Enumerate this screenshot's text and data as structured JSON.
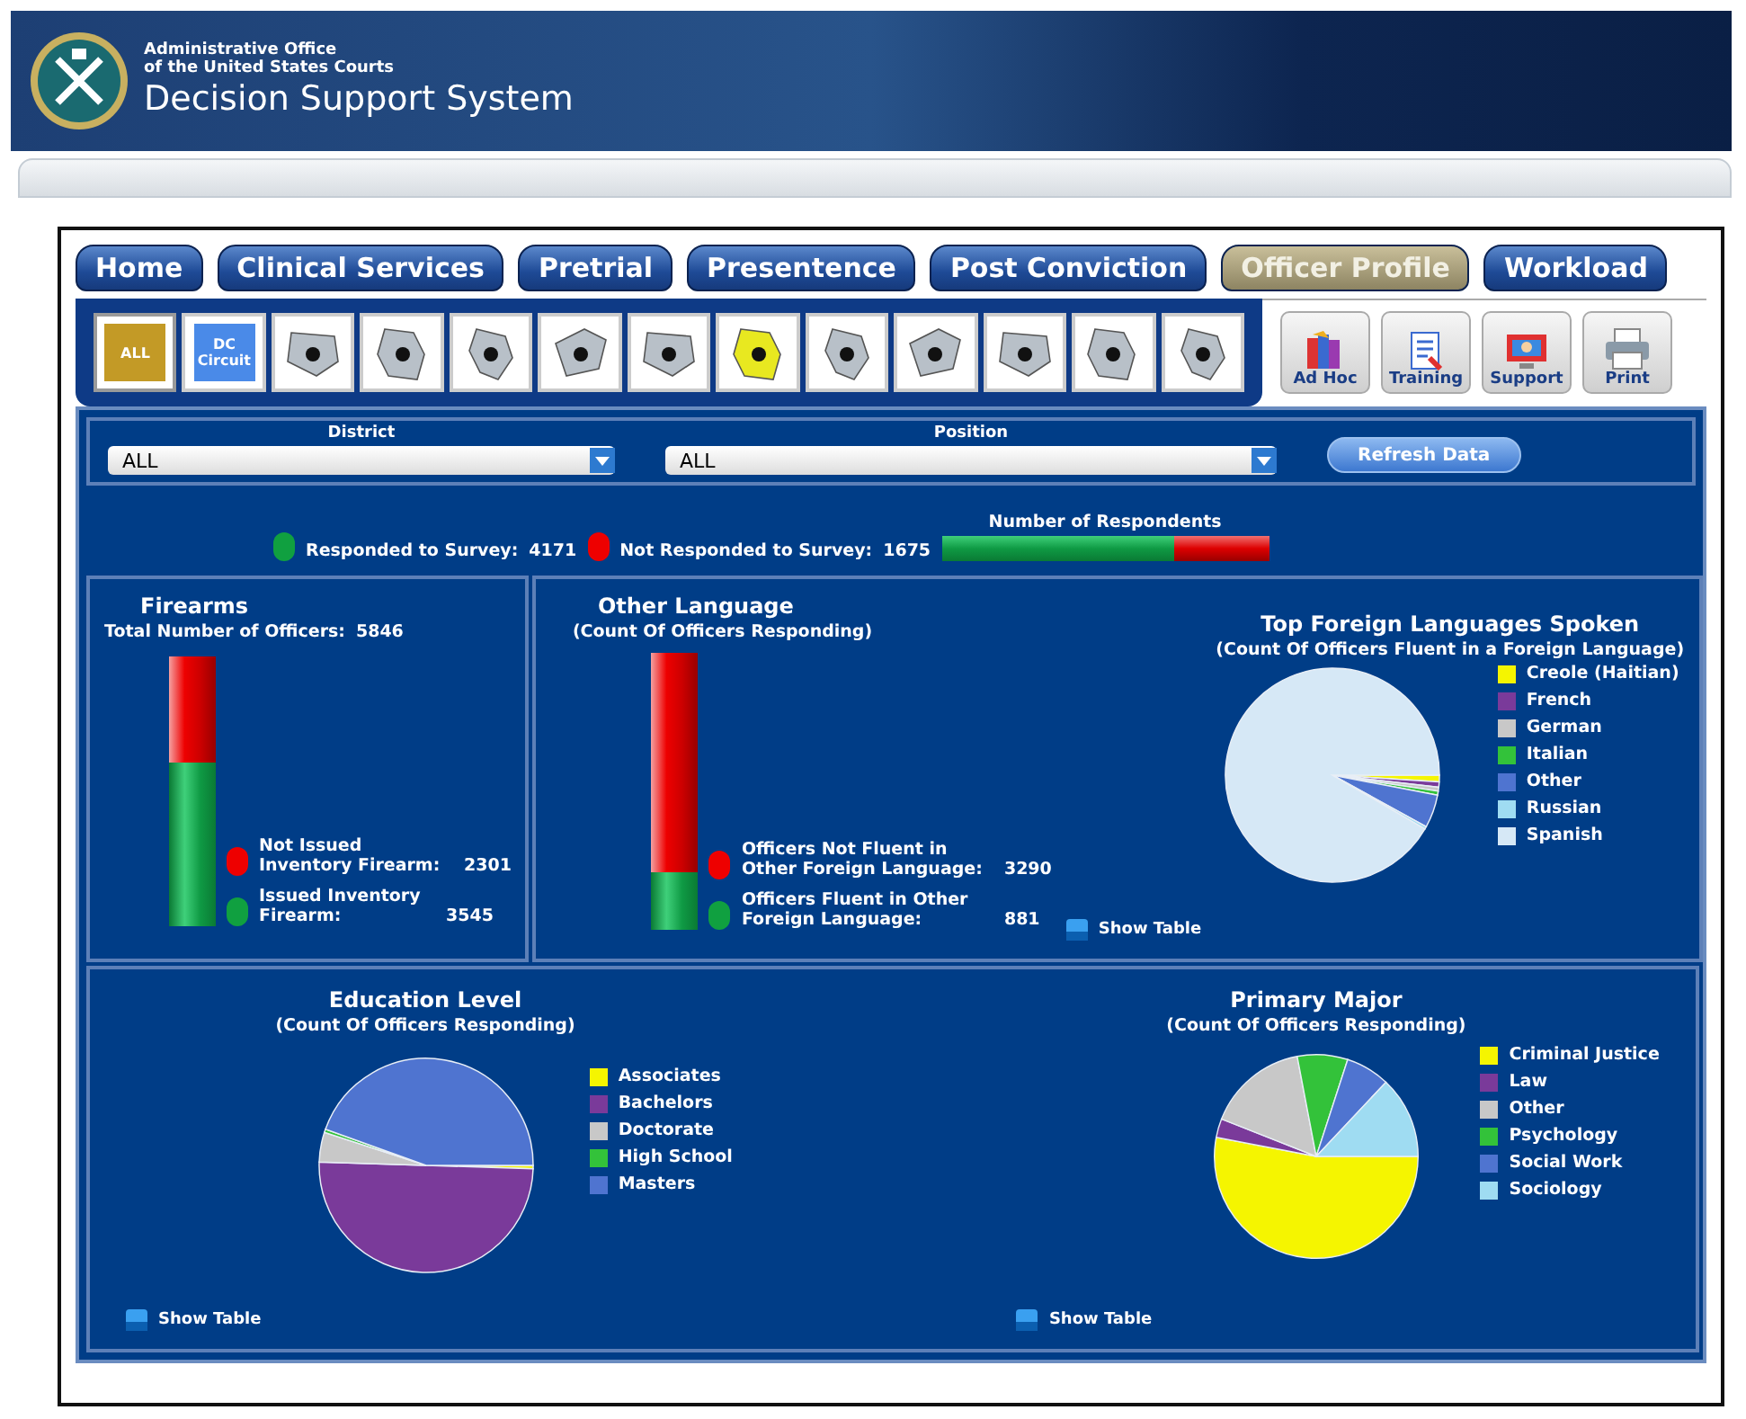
{
  "header": {
    "org_line_1": "Administrative Office",
    "org_line_2": "of the United States Courts",
    "title": "Decision Support System"
  },
  "tabs": [
    {
      "label": "Home",
      "selected": false
    },
    {
      "label": "Clinical Services",
      "selected": false
    },
    {
      "label": "Pretrial",
      "selected": false
    },
    {
      "label": "Presentence",
      "selected": false
    },
    {
      "label": "Post Conviction",
      "selected": false
    },
    {
      "label": "Officer Profile",
      "selected": true
    },
    {
      "label": "Workload",
      "selected": false
    }
  ],
  "districts": [
    {
      "kind": "label",
      "label": "ALL",
      "selected": true
    },
    {
      "kind": "label",
      "label": "DC Circuit",
      "selected": false
    },
    {
      "kind": "map",
      "selected": false
    },
    {
      "kind": "map",
      "selected": false
    },
    {
      "kind": "map",
      "selected": false
    },
    {
      "kind": "map",
      "selected": false
    },
    {
      "kind": "map",
      "selected": false
    },
    {
      "kind": "map",
      "selected": false
    },
    {
      "kind": "map",
      "selected": false
    },
    {
      "kind": "map",
      "selected": false
    },
    {
      "kind": "map",
      "selected": false
    },
    {
      "kind": "map",
      "selected": false
    },
    {
      "kind": "map",
      "selected": false
    }
  ],
  "tools": [
    {
      "kind": "adhoc",
      "label": "Ad Hoc"
    },
    {
      "kind": "training",
      "label": "Training"
    },
    {
      "kind": "support",
      "label": "Support"
    },
    {
      "kind": "print",
      "label": "Print"
    }
  ],
  "filters": {
    "district_label": "District",
    "district_value": "ALL",
    "position_label": "Position",
    "position_value": "ALL",
    "refresh": "Refresh Data"
  },
  "respondents": {
    "responded_label": "Responded to Survey:",
    "responded_value": "4171",
    "not_label": "Not Responded to Survey:",
    "not_value": "1675",
    "bar_title": "Number of Respondents",
    "level": 0.71
  },
  "firearms": {
    "title": "Firearms",
    "total_label": "Total Number of Officers:",
    "total_value": "5846",
    "level": 0.39,
    "not_issued_label": "Not Issued Inventory Firearm:",
    "not_issued_value": "2301",
    "issued_label": "Issued Inventory Firearm:",
    "issued_value": "3545"
  },
  "other_language": {
    "title": "Other Language",
    "subtitle": "(Count Of Officers Responding)",
    "level": 0.79,
    "not_fluent_label": "Officers Not Fluent in Other Foreign Language:",
    "not_fluent_value": "3290",
    "fluent_label": "Officers Fluent in Other Foreign Language:",
    "fluent_value": "881"
  },
  "foreign_languages": {
    "title": "Top Foreign Languages Spoken",
    "subtitle": "(Count Of Officers Fluent in a Foreign Language)",
    "show_table": "Show Table",
    "legend": [
      {
        "label": "Creole (Haitian)",
        "color": "#f5f500"
      },
      {
        "label": "French",
        "color": "#7a3a9a"
      },
      {
        "label": "German",
        "color": "#c8c8c8"
      },
      {
        "label": "Italian",
        "color": "#33c23a"
      },
      {
        "label": "Other",
        "color": "#4f74d0"
      },
      {
        "label": "Russian",
        "color": "#9fdcf2"
      },
      {
        "label": "Spanish",
        "color": "#d6e8f6"
      }
    ]
  },
  "education": {
    "title": "Education Level",
    "subtitle": "(Count Of Officers Responding)",
    "show_table": "Show Table",
    "legend": [
      {
        "label": "Associates",
        "color": "#f5f500"
      },
      {
        "label": "Bachelors",
        "color": "#7a3a9a"
      },
      {
        "label": "Doctorate",
        "color": "#c8c8c8"
      },
      {
        "label": "High School",
        "color": "#33c23a"
      },
      {
        "label": "Masters",
        "color": "#4f74d0"
      }
    ]
  },
  "major": {
    "title": "Primary Major",
    "subtitle": "(Count Of Officers Responding)",
    "show_table": "Show Table",
    "legend": [
      {
        "label": "Criminal Justice",
        "color": "#f5f500"
      },
      {
        "label": "Law",
        "color": "#7a3a9a"
      },
      {
        "label": "Other",
        "color": "#c8c8c8"
      },
      {
        "label": "Psychology",
        "color": "#33c23a"
      },
      {
        "label": "Social Work",
        "color": "#4f74d0"
      },
      {
        "label": "Sociology",
        "color": "#9fdcf2"
      }
    ]
  }
}
